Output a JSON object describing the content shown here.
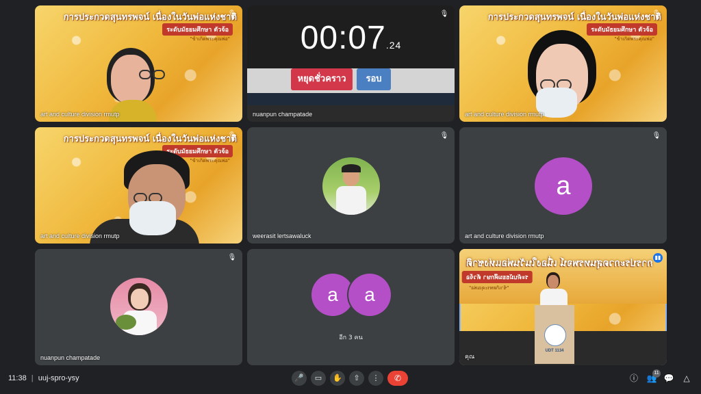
{
  "contest": {
    "title": "การประกวดสุนทรพจน์ เนื่องในวันพ่อแห่งชาติ",
    "level": "ระดับมัธยมศึกษา ตัวจ้อ",
    "subtitle": "\"ข้าเกิดพระคุณพ่อ\""
  },
  "timer": {
    "value": "00:07",
    "fraction": ".24",
    "stop_label": "หยุดชั่วคราว",
    "lap_label": "รอบ"
  },
  "tiles": [
    {
      "name": "art and culture division rmutp"
    },
    {
      "name": "nuanpun champatade"
    },
    {
      "name": "art and culture division rmutp"
    },
    {
      "name": "art and culture division rmutp"
    },
    {
      "name": "weerasit lertsawaluck"
    },
    {
      "name": "art and culture division rmutp",
      "avatar_letter": "a"
    },
    {
      "name": "nuanpun champatade"
    },
    {
      "name": "อีก 3 คน",
      "avatar_letter": "a"
    },
    {
      "name": "คุณ"
    }
  ],
  "speaker_tile": {
    "podium_label": "UDT 1134"
  },
  "bottom_bar": {
    "time": "11:38",
    "separator": "|",
    "meeting_code": "uuj-spro-ysy",
    "participants_count": "11"
  },
  "colors": {
    "background": "#202124",
    "tile": "#3c4043",
    "avatar": "#b44fc8",
    "end_call": "#ea4335",
    "active_border": "#8ab4f8"
  }
}
